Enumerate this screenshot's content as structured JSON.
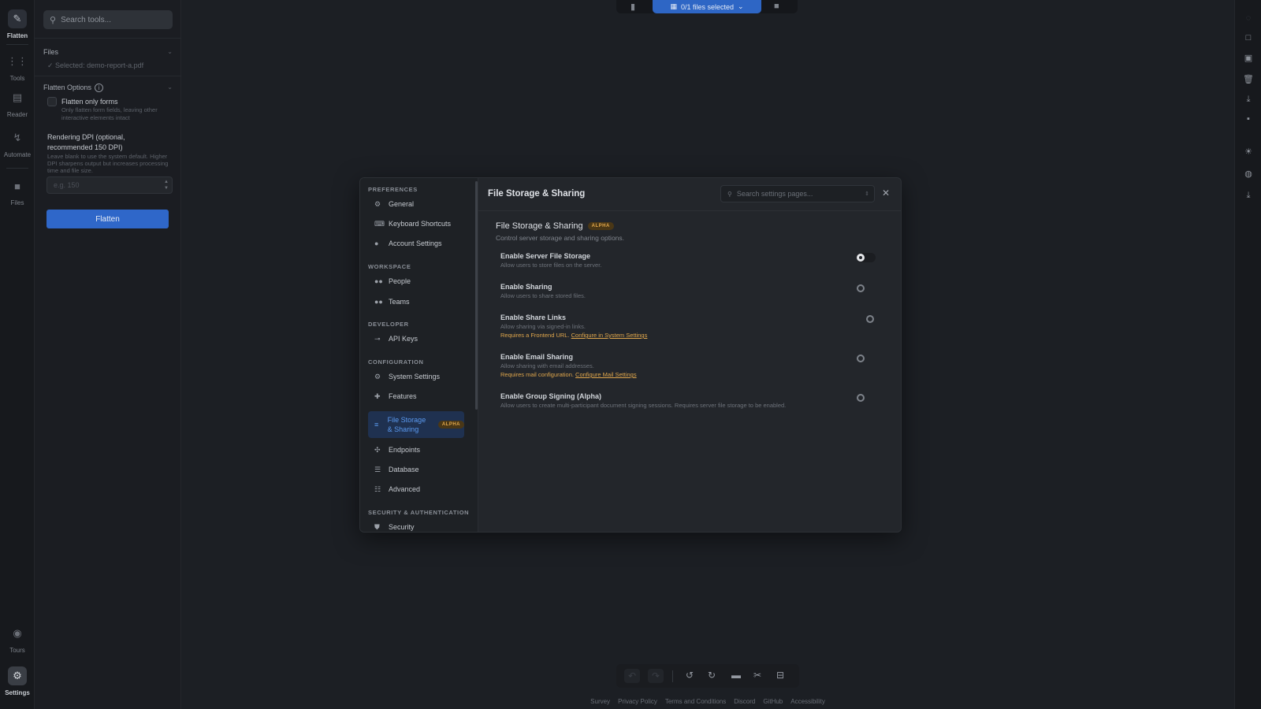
{
  "rail": {
    "items": [
      {
        "label": "Flatten",
        "icon": "flatten-icon"
      },
      {
        "label": "Tools",
        "icon": "grid-icon"
      },
      {
        "label": "Reader",
        "icon": "reader-icon"
      },
      {
        "label": "Automate",
        "icon": "automate-icon"
      },
      {
        "label": "Files",
        "icon": "folder-icon"
      },
      {
        "label": "Tours",
        "icon": "tours-icon"
      },
      {
        "label": "Settings",
        "icon": "gear-icon"
      }
    ]
  },
  "panel": {
    "search_placeholder": "Search tools...",
    "files_label": "Files",
    "selected_file": "✓ Selected: demo-report-a.pdf",
    "options_label": "Flatten Options",
    "checkbox_label": "Flatten only forms",
    "checkbox_desc": "Only flatten form fields, leaving other interactive elements intact",
    "dpi_label": "Rendering DPI (optional, recommended 150 DPI)",
    "dpi_desc": "Leave blank to use the system default. Higher DPI sharpens output but increases processing time and file size.",
    "dpi_placeholder": "e.g. 150",
    "flatten_button": "Flatten"
  },
  "topbar": {
    "files_selected": "0/1 files selected"
  },
  "footer": {
    "links": [
      "Survey",
      "Privacy Policy",
      "Terms and Conditions",
      "Discord",
      "GitHub",
      "Accessibility"
    ]
  },
  "modal": {
    "nav": {
      "preferences": "PREFERENCES",
      "general": "General",
      "keyboard": "Keyboard Shortcuts",
      "account": "Account Settings",
      "workspace": "WORKSPACE",
      "people": "People",
      "teams": "Teams",
      "developer": "DEVELOPER",
      "api_keys": "API Keys",
      "configuration": "CONFIGURATION",
      "system": "System Settings",
      "features": "Features",
      "file_storage": "File Storage & Sharing",
      "endpoints": "Endpoints",
      "database": "Database",
      "advanced": "Advanced",
      "security_auth": "SECURITY & AUTHENTICATION",
      "security": "Security"
    },
    "alpha_badge": "ALPHA",
    "title": "File Storage & Sharing",
    "search_placeholder": "Search settings pages...",
    "section_title": "File Storage & Sharing",
    "section_desc": "Control server storage and sharing options.",
    "options": [
      {
        "name": "Enable Server File Storage",
        "desc": "Allow users to store files on the server.",
        "enabled": true
      },
      {
        "name": "Enable Sharing",
        "desc": "Allow users to share stored files.",
        "enabled": false
      },
      {
        "name": "Enable Share Links",
        "desc": "Allow sharing via signed-in links.",
        "warn": "Requires a Frontend URL. ",
        "warn_link": "Configure in System Settings",
        "enabled": false
      },
      {
        "name": "Enable Email Sharing",
        "desc": "Allow sharing with email addresses.",
        "warn": "Requires mail configuration. ",
        "warn_link": "Configure Mail Settings",
        "enabled": false
      },
      {
        "name": "Enable Group Signing (Alpha)",
        "desc": "Allow users to create multi-participant document signing sessions. Requires server file storage to be enabled.",
        "enabled": false
      }
    ]
  },
  "colors": {
    "accent": "#2f67c9",
    "alpha": "#e0a74c",
    "background": "#1c1f24"
  }
}
